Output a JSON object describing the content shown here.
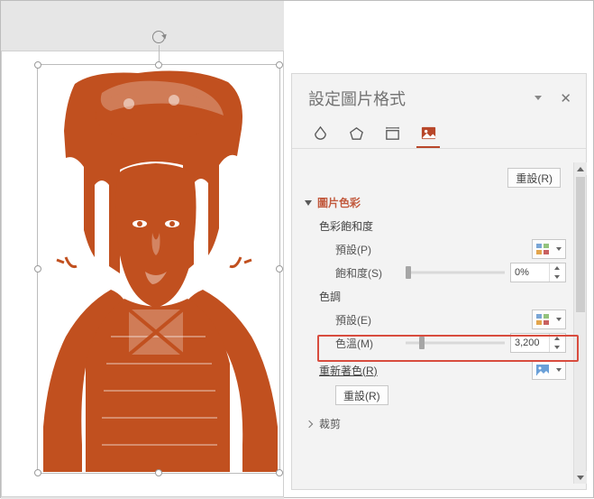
{
  "panel": {
    "title": "設定圖片格式",
    "reset_top": "重設(R)",
    "sections": {
      "color": {
        "header": "圖片色彩",
        "saturation": {
          "label": "色彩飽和度",
          "preset": "預設(P)",
          "sat_label": "飽和度(S)",
          "sat_value": "0%"
        },
        "tone": {
          "label": "色調",
          "preset": "預設(E)",
          "temp_label": "色溫(M)",
          "temp_value": "3,200"
        },
        "recolor": "重新著色(R)",
        "reset": "重設(R)"
      },
      "crop": "裁剪"
    }
  }
}
